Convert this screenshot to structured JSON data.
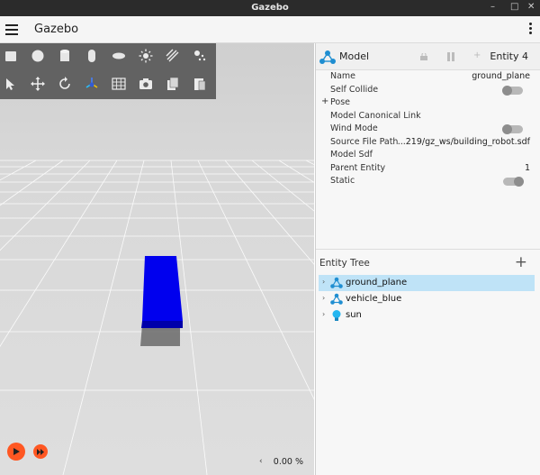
{
  "window": {
    "title": "Gazebo",
    "controls": [
      "–",
      "□",
      "✕"
    ]
  },
  "appbar": {
    "app_name": "Gazebo"
  },
  "toolbar": {
    "row1": [
      "box-icon",
      "sphere-icon",
      "cylinder-icon",
      "capsule-icon",
      "ellipsoid-icon",
      "sun-light-icon",
      "directional-light-icon",
      "spot-light-icon"
    ],
    "row2": [
      "select-arrow-icon",
      "translate-icon",
      "rotate-icon",
      "transform-icon",
      "grid-icon",
      "camera-icon",
      "copy-icon",
      "paste-icon"
    ]
  },
  "component_inspector": {
    "type_label": "Model",
    "entity_label": "Entity 4",
    "properties": [
      {
        "key": "Name",
        "value": "ground_plane"
      },
      {
        "key": "Self Collide",
        "value": "",
        "toggle": true,
        "on": false
      },
      {
        "key": "Pose",
        "value": "",
        "expandable": true,
        "prefix": "+"
      },
      {
        "key": "Model Canonical Link",
        "value": ""
      },
      {
        "key": "Wind Mode",
        "value": "",
        "toggle": true,
        "on": false
      },
      {
        "key": "Source File Path",
        "value": "...219/gz_ws/building_robot.sdf"
      },
      {
        "key": "Model Sdf",
        "value": ""
      },
      {
        "key": "Parent Entity",
        "value": "1"
      },
      {
        "key": "Static",
        "value": "",
        "toggle": true,
        "on": true
      }
    ]
  },
  "entity_tree": {
    "title": "Entity Tree",
    "add_label": "+",
    "items": [
      {
        "label": "ground_plane",
        "icon": "model-icon",
        "selected": true
      },
      {
        "label": "vehicle_blue",
        "icon": "model-icon",
        "selected": false
      },
      {
        "label": "sun",
        "icon": "light-bulb-icon",
        "selected": false
      }
    ]
  },
  "playback": {
    "rtf_label": "0.00 %",
    "rtf_arrow": "‹"
  },
  "colors": {
    "accent": "#ff5722",
    "selection": "#bfe3f7",
    "vehicle": "#0000ee",
    "toolbar": "#5d5d5d"
  }
}
